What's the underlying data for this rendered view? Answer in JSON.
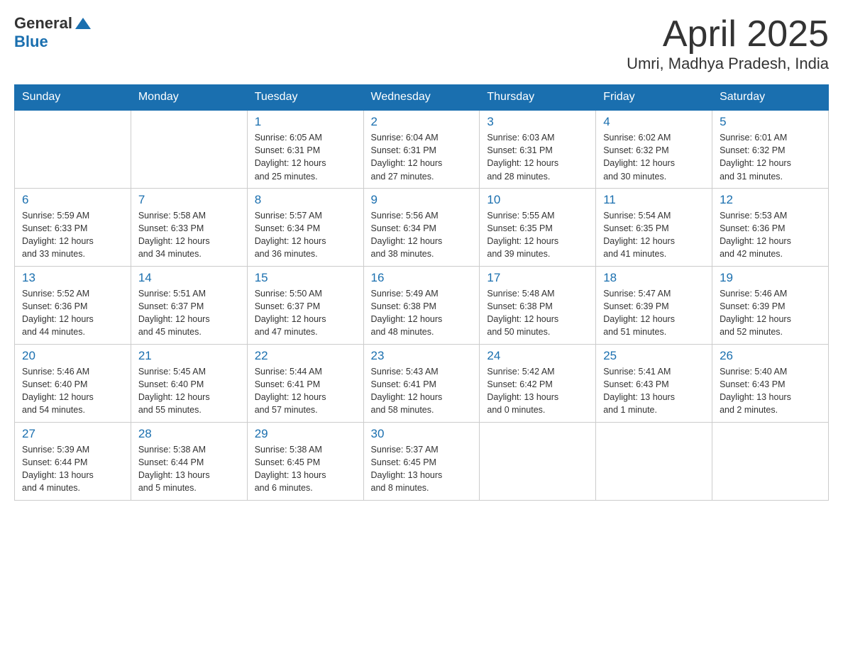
{
  "header": {
    "logo_general": "General",
    "logo_blue": "Blue",
    "title": "April 2025",
    "subtitle": "Umri, Madhya Pradesh, India"
  },
  "calendar": {
    "days_of_week": [
      "Sunday",
      "Monday",
      "Tuesday",
      "Wednesday",
      "Thursday",
      "Friday",
      "Saturday"
    ],
    "weeks": [
      [
        {
          "day": "",
          "info": ""
        },
        {
          "day": "",
          "info": ""
        },
        {
          "day": "1",
          "info": "Sunrise: 6:05 AM\nSunset: 6:31 PM\nDaylight: 12 hours\nand 25 minutes."
        },
        {
          "day": "2",
          "info": "Sunrise: 6:04 AM\nSunset: 6:31 PM\nDaylight: 12 hours\nand 27 minutes."
        },
        {
          "day": "3",
          "info": "Sunrise: 6:03 AM\nSunset: 6:31 PM\nDaylight: 12 hours\nand 28 minutes."
        },
        {
          "day": "4",
          "info": "Sunrise: 6:02 AM\nSunset: 6:32 PM\nDaylight: 12 hours\nand 30 minutes."
        },
        {
          "day": "5",
          "info": "Sunrise: 6:01 AM\nSunset: 6:32 PM\nDaylight: 12 hours\nand 31 minutes."
        }
      ],
      [
        {
          "day": "6",
          "info": "Sunrise: 5:59 AM\nSunset: 6:33 PM\nDaylight: 12 hours\nand 33 minutes."
        },
        {
          "day": "7",
          "info": "Sunrise: 5:58 AM\nSunset: 6:33 PM\nDaylight: 12 hours\nand 34 minutes."
        },
        {
          "day": "8",
          "info": "Sunrise: 5:57 AM\nSunset: 6:34 PM\nDaylight: 12 hours\nand 36 minutes."
        },
        {
          "day": "9",
          "info": "Sunrise: 5:56 AM\nSunset: 6:34 PM\nDaylight: 12 hours\nand 38 minutes."
        },
        {
          "day": "10",
          "info": "Sunrise: 5:55 AM\nSunset: 6:35 PM\nDaylight: 12 hours\nand 39 minutes."
        },
        {
          "day": "11",
          "info": "Sunrise: 5:54 AM\nSunset: 6:35 PM\nDaylight: 12 hours\nand 41 minutes."
        },
        {
          "day": "12",
          "info": "Sunrise: 5:53 AM\nSunset: 6:36 PM\nDaylight: 12 hours\nand 42 minutes."
        }
      ],
      [
        {
          "day": "13",
          "info": "Sunrise: 5:52 AM\nSunset: 6:36 PM\nDaylight: 12 hours\nand 44 minutes."
        },
        {
          "day": "14",
          "info": "Sunrise: 5:51 AM\nSunset: 6:37 PM\nDaylight: 12 hours\nand 45 minutes."
        },
        {
          "day": "15",
          "info": "Sunrise: 5:50 AM\nSunset: 6:37 PM\nDaylight: 12 hours\nand 47 minutes."
        },
        {
          "day": "16",
          "info": "Sunrise: 5:49 AM\nSunset: 6:38 PM\nDaylight: 12 hours\nand 48 minutes."
        },
        {
          "day": "17",
          "info": "Sunrise: 5:48 AM\nSunset: 6:38 PM\nDaylight: 12 hours\nand 50 minutes."
        },
        {
          "day": "18",
          "info": "Sunrise: 5:47 AM\nSunset: 6:39 PM\nDaylight: 12 hours\nand 51 minutes."
        },
        {
          "day": "19",
          "info": "Sunrise: 5:46 AM\nSunset: 6:39 PM\nDaylight: 12 hours\nand 52 minutes."
        }
      ],
      [
        {
          "day": "20",
          "info": "Sunrise: 5:46 AM\nSunset: 6:40 PM\nDaylight: 12 hours\nand 54 minutes."
        },
        {
          "day": "21",
          "info": "Sunrise: 5:45 AM\nSunset: 6:40 PM\nDaylight: 12 hours\nand 55 minutes."
        },
        {
          "day": "22",
          "info": "Sunrise: 5:44 AM\nSunset: 6:41 PM\nDaylight: 12 hours\nand 57 minutes."
        },
        {
          "day": "23",
          "info": "Sunrise: 5:43 AM\nSunset: 6:41 PM\nDaylight: 12 hours\nand 58 minutes."
        },
        {
          "day": "24",
          "info": "Sunrise: 5:42 AM\nSunset: 6:42 PM\nDaylight: 13 hours\nand 0 minutes."
        },
        {
          "day": "25",
          "info": "Sunrise: 5:41 AM\nSunset: 6:43 PM\nDaylight: 13 hours\nand 1 minute."
        },
        {
          "day": "26",
          "info": "Sunrise: 5:40 AM\nSunset: 6:43 PM\nDaylight: 13 hours\nand 2 minutes."
        }
      ],
      [
        {
          "day": "27",
          "info": "Sunrise: 5:39 AM\nSunset: 6:44 PM\nDaylight: 13 hours\nand 4 minutes."
        },
        {
          "day": "28",
          "info": "Sunrise: 5:38 AM\nSunset: 6:44 PM\nDaylight: 13 hours\nand 5 minutes."
        },
        {
          "day": "29",
          "info": "Sunrise: 5:38 AM\nSunset: 6:45 PM\nDaylight: 13 hours\nand 6 minutes."
        },
        {
          "day": "30",
          "info": "Sunrise: 5:37 AM\nSunset: 6:45 PM\nDaylight: 13 hours\nand 8 minutes."
        },
        {
          "day": "",
          "info": ""
        },
        {
          "day": "",
          "info": ""
        },
        {
          "day": "",
          "info": ""
        }
      ]
    ]
  }
}
